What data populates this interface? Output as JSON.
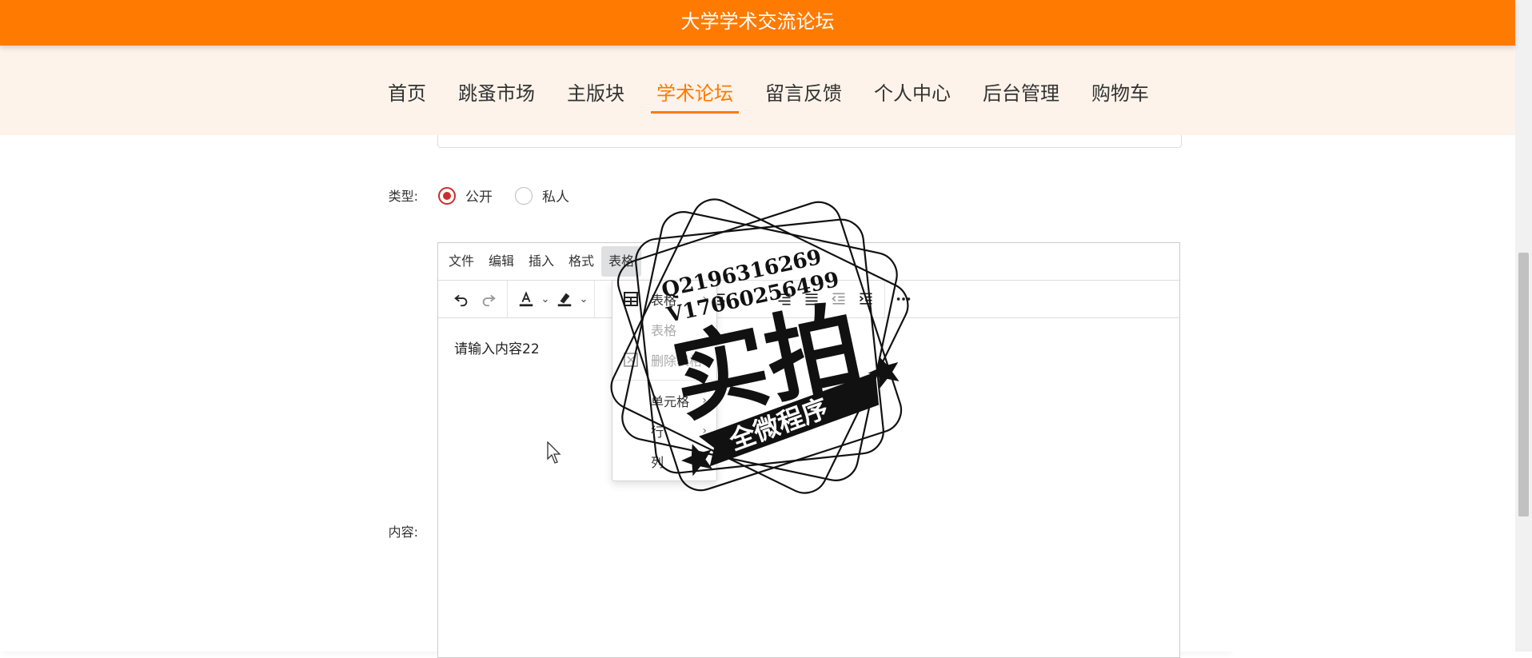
{
  "site": {
    "title": "大学学术交流论坛"
  },
  "nav": {
    "items": [
      {
        "label": "首页"
      },
      {
        "label": "跳蚤市场"
      },
      {
        "label": "主版块"
      },
      {
        "label": "学术论坛",
        "active": true
      },
      {
        "label": "留言反馈"
      },
      {
        "label": "个人中心"
      },
      {
        "label": "后台管理"
      },
      {
        "label": "购物车"
      }
    ]
  },
  "form": {
    "type_label": "类型:",
    "type_options": [
      {
        "label": "公开",
        "checked": true
      },
      {
        "label": "私人",
        "checked": false
      }
    ],
    "content_label": "内容:"
  },
  "editor": {
    "menus": [
      "文件",
      "编辑",
      "插入",
      "格式",
      "表格"
    ],
    "open_menu": "表格",
    "content": "请输入内容22",
    "toolbar_icons": [
      "undo-icon",
      "redo-icon",
      "text-color-icon",
      "highlight-icon",
      "strikethrough-icon",
      "align-left-icon",
      "align-center-icon",
      "align-right-icon",
      "justify-icon",
      "outdent-icon",
      "indent-icon",
      "more-icon"
    ]
  },
  "table_menu": {
    "items": [
      {
        "label": "表格",
        "has_submenu": true,
        "disabled": false
      },
      {
        "label": "表格",
        "disabled": true
      },
      {
        "label": "删除表格",
        "disabled": true
      },
      {
        "label": "单元格",
        "has_submenu": true,
        "disabled": false
      },
      {
        "label": "行",
        "has_submenu": true,
        "disabled": false
      },
      {
        "label": "列",
        "has_submenu": true,
        "disabled": false
      }
    ]
  },
  "watermark": {
    "line1": "Q2196316269",
    "line2": "V17060256499",
    "main": "实拍",
    "ribbon": "全微程序"
  },
  "colors": {
    "brand": "#ff7a00",
    "nav_bg": "#fdf3ea",
    "radio_checked": "#c9302c"
  }
}
